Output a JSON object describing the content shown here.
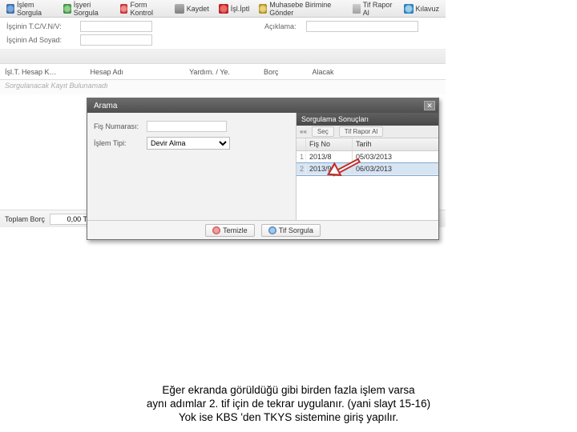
{
  "toolbar": {
    "islem_sorgula": "İşlem Sorgula",
    "isyeri_sorgula": "İşyeri Sorgula",
    "form_kontrol": "Form Kontrol",
    "kaydet": "Kaydet",
    "iptal": "İşl.İptl",
    "kbs": "Muhasebe Birimine Gönder",
    "rapor": "Tif Rapor Al",
    "kilavuz": "Kılavuz"
  },
  "form": {
    "tckn_label": "İşçinin T.C/V.N/V:",
    "adsoyad_label": "İşçinin Ad Soyad:",
    "aciklama_label": "Açıklama:",
    "tckn_value": "",
    "adsoyad_value": "",
    "aciklama_value": ""
  },
  "grid": {
    "col1": "İşl.T. Hesap K…",
    "col2": "Hesap Adı",
    "col3": "Yardım. / Ye.",
    "col4": "Borç",
    "col5": "Alacak",
    "empty_hint": "Sorgulanacak Kayıt Bulunamadı"
  },
  "totals": {
    "label": "Toplam Borç",
    "value": "0,00 T"
  },
  "dialog": {
    "title": "Arama",
    "fis_label": "Fiş Numarası:",
    "fis_value": "",
    "islem_label": "İşlem Tipi:",
    "islem_selected": "Devir Alma",
    "results_title": "Sorgulama Sonuçları",
    "sub_sec": "Seç",
    "sub_rapor": "Tif Rapor Al",
    "hdr_fisno": "Fiş No",
    "hdr_tarih": "Tarih",
    "rows": [
      {
        "fis": "2013/8",
        "tarih": "05/03/2013"
      },
      {
        "fis": "2013/9",
        "tarih": "06/03/2013"
      }
    ],
    "btn_temizle": "Temizle",
    "btn_sorgula": "Tif Sorgula"
  },
  "caption": {
    "l1": "Eğer  ekranda görüldüğü gibi birden fazla işlem varsa",
    "l2": "aynı adımlar  2. tif için de tekrar uygulanır. (yani slayt 15-16)",
    "l3": "Yok ise KBS 'den TKYS sistemine giriş yapılır."
  }
}
